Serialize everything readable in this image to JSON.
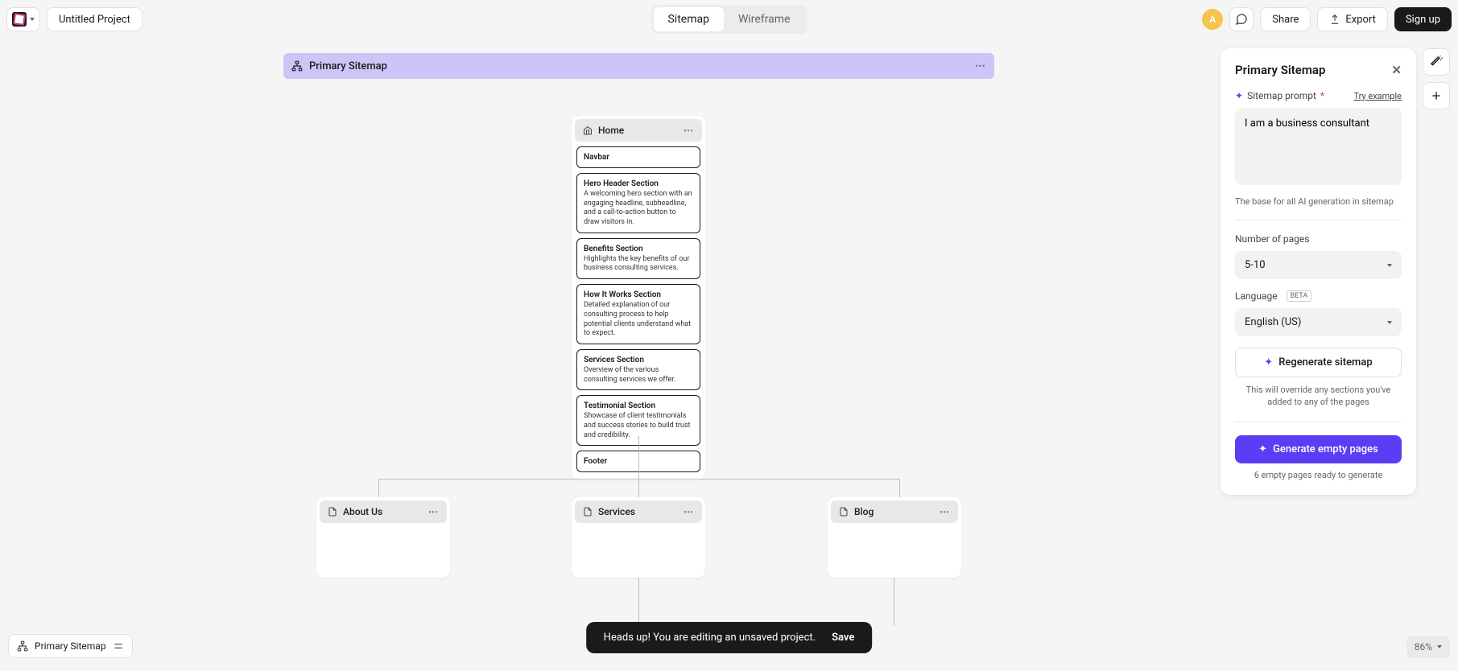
{
  "topbar": {
    "project_name": "Untitled Project",
    "tabs": {
      "sitemap": "Sitemap",
      "wireframe": "Wireframe"
    },
    "avatar_initial": "A",
    "share": "Share",
    "export": "Export",
    "signup": "Sign up"
  },
  "sitemap_bar": {
    "title": "Primary Sitemap"
  },
  "home_page": {
    "name": "Home",
    "sections": [
      {
        "title": "Navbar",
        "desc": ""
      },
      {
        "title": "Hero Header Section",
        "desc": "A welcoming hero section with an engaging headline, subheadline, and a call-to-action button to draw visitors in."
      },
      {
        "title": "Benefits Section",
        "desc": "Highlights the key benefits of our business consulting services."
      },
      {
        "title": "How It Works Section",
        "desc": "Detailed explanation of our consulting process to help potential clients understand what to expect."
      },
      {
        "title": "Services Section",
        "desc": "Overview of the various consulting services we offer."
      },
      {
        "title": "Testimonial Section",
        "desc": "Showcase of client testimonials and success stories to build trust and credibility."
      },
      {
        "title": "Footer",
        "desc": ""
      }
    ]
  },
  "child_pages": {
    "about": "About Us",
    "services": "Services",
    "blog": "Blog"
  },
  "panel": {
    "title": "Primary Sitemap",
    "prompt_label": "Sitemap prompt",
    "try_example": "Try example",
    "prompt_value": "I am a business consultant",
    "prompt_help": "The base for all AI generation in sitemap",
    "num_pages_label": "Number of pages",
    "num_pages_value": "5-10",
    "language_label": "Language",
    "language_beta": "BETA",
    "language_value": "English (US)",
    "regen": "Regenerate sitemap",
    "regen_caption": "This will override any sections you've added to any of the pages",
    "generate": "Generate empty pages",
    "ready": "6 empty pages ready to generate"
  },
  "toast": {
    "msg": "Heads up! You are editing an unsaved project.",
    "save": "Save"
  },
  "bottom_left": "Primary Sitemap",
  "zoom": "86%"
}
